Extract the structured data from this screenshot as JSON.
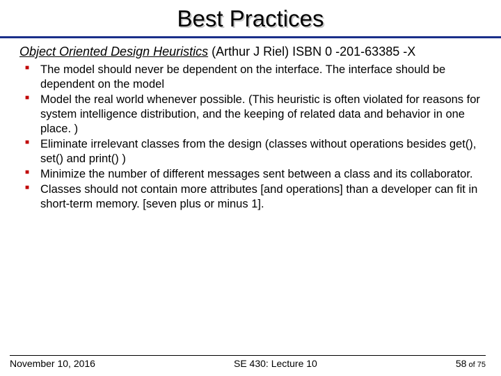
{
  "title": "Best Practices",
  "reference": {
    "book": "Object Oriented Design Heuristics",
    "rest": " (Arthur J Riel) ISBN 0 -201-63385 -X"
  },
  "bullets": [
    "The model should never be dependent on the interface. The interface should be dependent on the model",
    "Model the real world whenever possible. (This heuristic is often violated for reasons for system intelligence distribution, and the keeping of related data and behavior in one place. )",
    "Eliminate irrelevant classes from the design (classes without operations besides get(), set() and print() )",
    "Minimize the number of different messages sent between a class and its collaborator.",
    "Classes should not contain more attributes [and operations] than a developer can fit in short-term memory. [seven plus or minus 1]."
  ],
  "footer": {
    "date": "November 10, 2016",
    "course": "SE 430: Lecture 10",
    "page_current": "58",
    "page_sep": " of ",
    "page_total": "75"
  }
}
